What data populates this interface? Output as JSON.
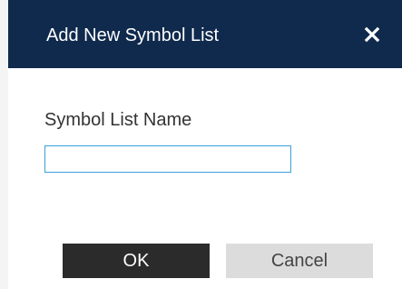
{
  "dialog": {
    "title": "Add New Symbol List",
    "close_icon": "close-icon",
    "field_label": "Symbol List Name",
    "input_value": "",
    "input_placeholder": "",
    "ok_label": "OK",
    "cancel_label": "Cancel"
  },
  "colors": {
    "titlebar": "#0f2a4d",
    "input_border": "#3aa0d8",
    "ok_button": "#2b2b2b",
    "cancel_button": "#dcdcdc"
  }
}
